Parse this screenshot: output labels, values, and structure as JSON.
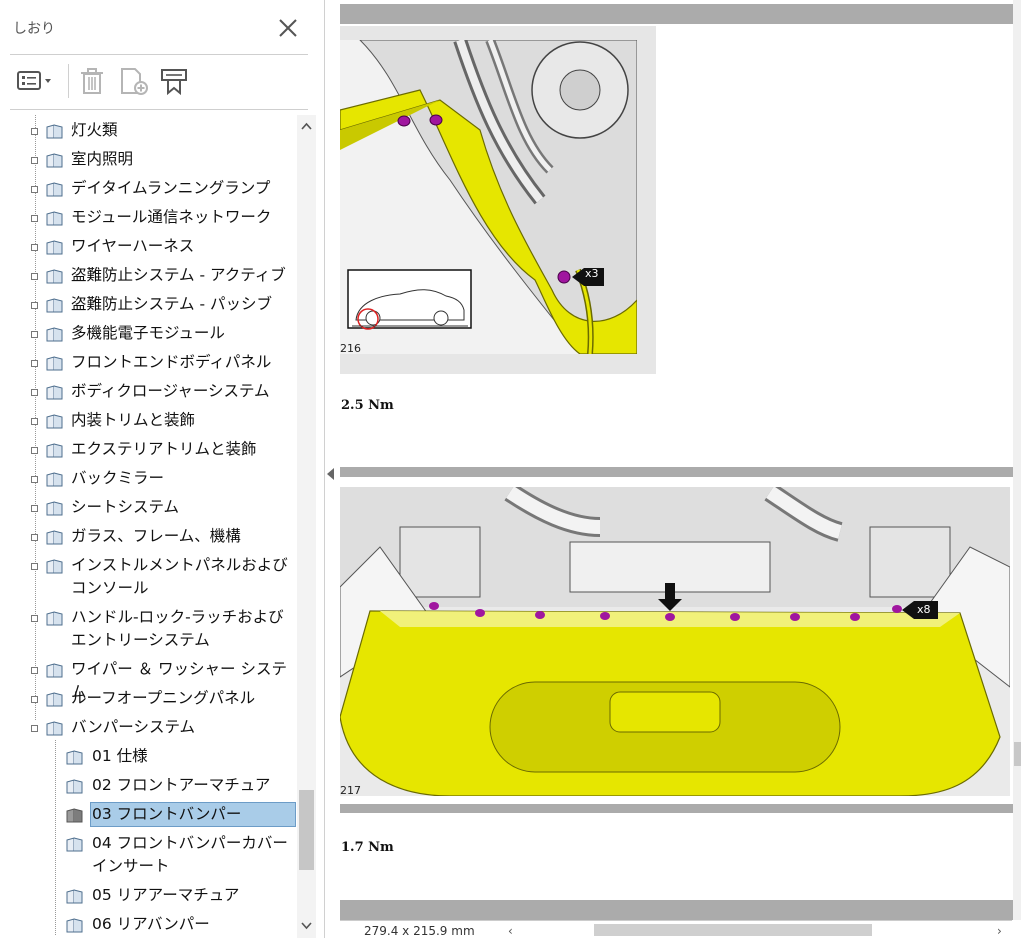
{
  "panel": {
    "title": "しおり",
    "tree": [
      {
        "label": "灯火類",
        "level": 0
      },
      {
        "label": "室内照明",
        "level": 0
      },
      {
        "label": "デイタイムランニングランプ",
        "level": 0
      },
      {
        "label": "モジュール通信ネットワーク",
        "level": 0
      },
      {
        "label": "ワイヤーハーネス",
        "level": 0
      },
      {
        "label": "盗難防止システム - アクティブ",
        "level": 0
      },
      {
        "label": "盗難防止システム - パッシブ",
        "level": 0
      },
      {
        "label": "多機能電子モジュール",
        "level": 0
      },
      {
        "label": "フロントエンドボディパネル",
        "level": 0
      },
      {
        "label": "ボディクロージャーシステム",
        "level": 0
      },
      {
        "label": "内装トリムと装飾",
        "level": 0
      },
      {
        "label": "エクステリアトリムと装飾",
        "level": 0
      },
      {
        "label": "バックミラー",
        "level": 0
      },
      {
        "label": "シートシステム",
        "level": 0
      },
      {
        "label": "ガラス、フレーム、機構",
        "level": 0
      },
      {
        "label": "インストルメントパネルおよびコンソール",
        "level": 0
      },
      {
        "label": "ハンドル-ロック-ラッチおよびエントリーシステム",
        "level": 0
      },
      {
        "label": "ワイパー ＆ ワッシャー システム",
        "level": 0
      },
      {
        "label": "ルーフオープニングパネル",
        "level": 0
      },
      {
        "label": "バンパーシステム",
        "level": 0
      },
      {
        "label": "01 仕様",
        "level": 1
      },
      {
        "label": "02 フロントアーマチュア",
        "level": 1
      },
      {
        "label": "03 フロントバンパー",
        "level": 1
      },
      {
        "label": "04 フロントバンパーカバーインサート",
        "level": 1
      },
      {
        "label": "05 リアアーマチュア",
        "level": 1
      },
      {
        "label": "06 リアバンパー",
        "level": 1
      }
    ]
  },
  "document": {
    "fig1_number": "216",
    "fig1_callout": "x3",
    "torque1": "2.5 Nm",
    "fig2_number": "217",
    "fig2_callout": "x8",
    "torque2": "1.7 Nm"
  },
  "status": {
    "page_size": "279.4 x 215.9 mm",
    "left_arrow": "‹",
    "right_arrow": "›"
  },
  "colors": {
    "selected_bg": "#a9cce8",
    "part_yellow": "#e6e600",
    "fastener_purple": "#a0169f"
  }
}
